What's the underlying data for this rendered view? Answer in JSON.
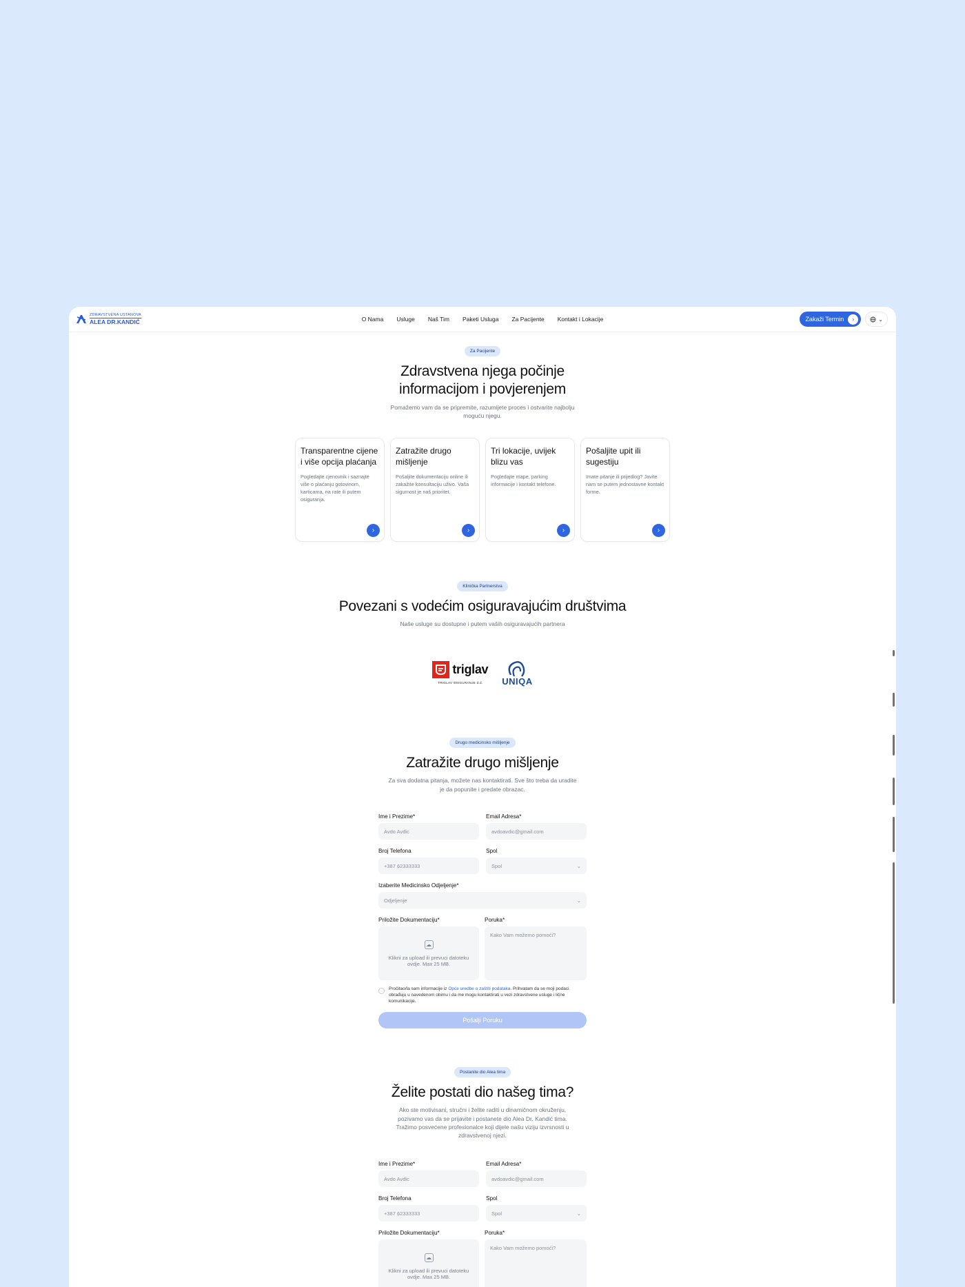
{
  "nav": {
    "logo_small": "ZDRAVSTVENA USTANOVA",
    "logo_big": "ALEA DR.KANDIĆ",
    "links": [
      "O Nama",
      "Usluge",
      "Naš Tim",
      "Paketi Usluga",
      "Za Pacijente",
      "Kontakt i Lokacije"
    ],
    "cta": "Zakaži Termin",
    "lang_icon": "globe-icon"
  },
  "hero": {
    "pill": "Za Pacijente",
    "title_l1": "Zdravstvena njega počinje",
    "title_l2": "informacijom i povjerenjem",
    "sub_l1": "Pomažemo vam da se pripremite, razumijete proces i ostvarite najbolju",
    "sub_l2": "moguću njegu.",
    "cards": [
      {
        "title": "Transparentne cijene i više opcija plaćanja",
        "desc": "Pogledajte cjenovnik i saznajte više o plaćanju gotovinom, karticama, na rate ili putem osiguranja."
      },
      {
        "title": "Zatražite drugo mišljenje",
        "desc": "Pošaljite dokumentaciju online ili zakažite konsultaciju uživo. Vaša sigurnost je naš prioritet."
      },
      {
        "title": "Tri lokacije, uvijek blizu vas",
        "desc": "Pogledajte mape, parking informacije i kontakt telefone."
      },
      {
        "title": "Pošaljite upit ili sugestiju",
        "desc": "Imate pitanje ili prijedlog? Javite nam se putem jednostavne kontakt forme."
      }
    ]
  },
  "partners": {
    "pill": "Klinička Partnerstva",
    "title": "Povezani s vodećim osiguravajućim društvima",
    "sub": "Naše usluge su dostupne i putem vaših osiguravajućih partnera",
    "triglav_word": "triglav",
    "triglav_sub": "TRIGLAV OSIGURANJE d.d.",
    "uniqa_word": "UNIQA"
  },
  "second_opinion": {
    "pill": "Drugo medicinsko mišljenje",
    "title": "Zatražite drugo mišljenje",
    "sub_l1": "Za sva dodatna pitanja, možete nas kontaktirati. Sve što treba da uradite",
    "sub_l2": "je da popunite i predate obrazac.",
    "name_label": "Ime i Prezime*",
    "name_value": "Avdo Avdic",
    "email_label": "Email Adresa*",
    "email_value": "avdoavdic@gmail.com",
    "phone_label": "Broj Telefona",
    "phone_value": "+387 62333333",
    "gender_label": "Spol",
    "gender_value": "Spol",
    "dept_label": "Izaberite Medicinsko Odjeljenje*",
    "dept_value": "Odjeljenje",
    "docs_label": "Priložite Dokumentaciju*",
    "docs_text": "Klikni za upload ili prevuci datoteku ovdje. Max 25 MB.",
    "msg_label": "Poruka*",
    "msg_placeholder": "Kako Vam možemo pomoći?",
    "consent_pre": "Pročitao/la sam informacije iz ",
    "consent_link": "Opće uredbe o zaštiti podataka",
    "consent_post": ". Prihvatam da se moji podaci obrađuju u navedenom obimu i da me mogu kontaktirati u vezi zdravstvene usluge i lične komunikacije.",
    "submit": "Pošalji Poruku"
  },
  "careers": {
    "pill": "Postanite dio Alea tima",
    "title": "Želite postati dio našeg tima?",
    "sub_l1": "Ako ste motivisani, stručni i želite raditi u dinamičnom okruženju,",
    "sub_l2": "pozivamo vas da se prijavite i postanete dio Alea Dr. Kandić tima.",
    "sub_l3": "Tražimo posvećene profesionalce koji dijele našu viziju izvrsnosti u",
    "sub_l4": "zdravstvenoj njezi.",
    "name_label": "Ime i Prezime*",
    "name_value": "Avdo Avdic",
    "email_label": "Email Adresa*",
    "email_value": "avdoavdic@gmail.com",
    "phone_label": "Broj Telefona",
    "phone_value": "+387 62333333",
    "gender_label": "Spol",
    "gender_value": "Spol",
    "docs_label": "Priložite Dokumentaciju*",
    "docs_text": "Klikni za upload ili prevuci datoteku ovdje. Max 25 MB.",
    "msg_label": "Poruka*",
    "msg_placeholder": "Kako Vam možemo pomoći?"
  }
}
